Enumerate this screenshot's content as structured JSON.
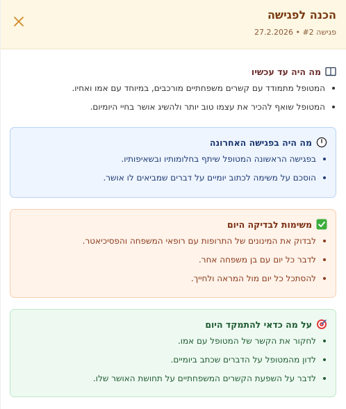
{
  "header": {
    "title": "הכנה לפגישה",
    "subtitle": "פגישה #2 • 27.2.2026",
    "close_icon": "close-icon"
  },
  "sections": {
    "so_far": {
      "title": "מה היה עד עכשיו",
      "icon": "book-icon",
      "items": [
        "המטופל מתמודד עם קשרים משפחתיים מורכבים, במיוחד עם אמו ואחיו.",
        "המטופל שואף להכיר את עצמו טוב יותר ולהשיג אושר בחיי היומיום."
      ]
    },
    "last_meeting": {
      "title": "מה היה בפגישה האחרונה",
      "icon": "clock-icon",
      "items": [
        "בפגישה הראשונה המטופל שיתף בחלומותיו ובשאיפותיו.",
        "הוסכם על משימה לכתוב יומיים על דברים שמביאים לו אושר."
      ]
    },
    "tasks": {
      "title": "משימות לבדיקה היום",
      "icon": "checkbox-icon",
      "items": [
        "לבדוק את המינונים של התרופות עם רופאי המשפחה והפסיכיאטר.",
        "לדבר כל יום עם בן משפחה אחר.",
        "להסתכל כל יום מול המראה ולחייך."
      ]
    },
    "focus": {
      "title": "על מה כדאי להתמקד היום",
      "icon": "target-icon",
      "items": [
        "לחקור את הקשר של המטופל עם אמו.",
        "לדון מהמטופל על הדברים שכתב ביומיים.",
        "לדבר על השפעת הקשרים המשפחתיים על תחושת האושר שלו."
      ]
    }
  },
  "colors": {
    "header_bg": "#fdf7e3",
    "title": "#7a3b12",
    "close": "#d08a2a",
    "blue_bg": "#eef5ff",
    "orange_bg": "#fff3ea",
    "green_bg": "#eefaf1"
  }
}
